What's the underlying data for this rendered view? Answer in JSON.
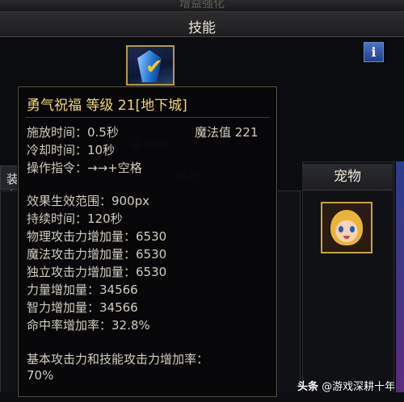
{
  "window": {
    "title": "增益强化"
  },
  "skill_bar": {
    "title": "技能"
  },
  "skill_icon": "crystal-check-icon",
  "info_button": {
    "label": "i"
  },
  "equip_tab": {
    "label": "装备"
  },
  "pet_panel": {
    "title": "宠物"
  },
  "tooltip": {
    "title": "勇气祝福 等级 21[地下城]",
    "cast_time": "施放时间：0.5秒",
    "mana": "魔法值 221",
    "cooldown": "冷却时间：10秒",
    "command": "操作指令：→→+空格",
    "effect_range": "效果生效范围：900px",
    "duration": "持续时间：120秒",
    "phys_atk": "物理攻击力增加量：6530",
    "mag_atk": "魔法攻击力增加量：6530",
    "ind_atk": "独立攻击力增加量：6530",
    "str_inc": "力量增加量：34566",
    "int_inc": "智力增加量：34566",
    "hit_rate": "命中率增加率：32.8%",
    "base_atk_line1": "基本攻击力和技能攻击力增加率：",
    "base_atk_line2": "70%"
  },
  "watermark": {
    "logo": "头条",
    "account": "@游戏深耕十年"
  }
}
